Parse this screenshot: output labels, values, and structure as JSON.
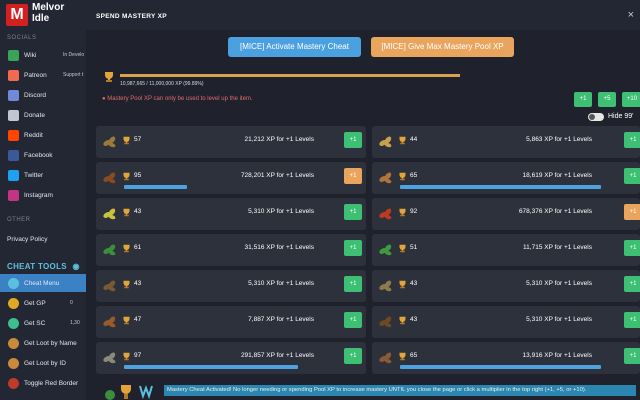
{
  "sidebar": {
    "logo": {
      "line1": "Melvor",
      "line2": "Idle"
    },
    "socials_heading": "SOCIALS",
    "socials": [
      {
        "label": "Wiki",
        "extra": "In Develo",
        "icon": "wiki-icon",
        "color": "#3aa35b"
      },
      {
        "label": "Patreon",
        "extra": "Support t",
        "icon": "patreon-icon",
        "color": "#f06a4f"
      },
      {
        "label": "Discord",
        "extra": "",
        "icon": "discord-icon",
        "color": "#7289da"
      },
      {
        "label": "Donate",
        "extra": "",
        "icon": "donate-icon",
        "color": "#c1c6d2"
      },
      {
        "label": "Reddit",
        "extra": "",
        "icon": "reddit-icon",
        "color": "#ff4500"
      },
      {
        "label": "Facebook",
        "extra": "",
        "icon": "facebook-icon",
        "color": "#3b5998"
      },
      {
        "label": "Twitter",
        "extra": "",
        "icon": "twitter-icon",
        "color": "#1da1f2"
      },
      {
        "label": "Instagram",
        "extra": "",
        "icon": "instagram-icon",
        "color": "#c13584"
      }
    ],
    "other_heading": "OTHER",
    "privacy": "Privacy Policy",
    "cheat_heading": "CHEAT TOOLS",
    "cheats": [
      {
        "label": "Cheat Menu",
        "extra": "",
        "icon": "cheat-menu-icon",
        "color": "#5bc0de"
      },
      {
        "label": "Get GP",
        "extra": "0",
        "icon": "gp-coin-icon",
        "color": "#e0a823"
      },
      {
        "label": "Get SC",
        "extra": "1,30",
        "icon": "sc-coin-icon",
        "color": "#3bbf8c"
      },
      {
        "label": "Get Loot by Name",
        "extra": "",
        "icon": "chest-icon",
        "color": "#c98a3c"
      },
      {
        "label": "Get Loot by ID",
        "extra": "",
        "icon": "chest-id-icon",
        "color": "#c98a3c"
      },
      {
        "label": "Toggle Red Border",
        "extra": "",
        "icon": "red-border-icon",
        "color": "#c0392b"
      }
    ]
  },
  "modal": {
    "title": "SPEND MASTERY XP",
    "close": "×",
    "activate_button": "[MICE] Activate Mastery Cheat",
    "max_pool_button": "[MICE] Give Max Mastery Pool XP",
    "pool_text": "10,987,665 / 11,000,000 XP (99.89%)",
    "pool_fraction": 0.9989,
    "warning": "Mastery Pool XP can only be used to level up the item.",
    "multipliers": [
      "+1",
      "+5",
      "+10"
    ],
    "hide_label": "Hide 99'",
    "items": [
      {
        "level": "57",
        "xp": "21,212 XP for +1 Levels",
        "plus": "+1",
        "progress": 0,
        "leaf_color": "#9b7a3a",
        "plus_color": "green"
      },
      {
        "level": "44",
        "xp": "5,863 XP for +1 Levels",
        "plus": "+1",
        "progress": 0,
        "leaf_color": "#c9a04c",
        "plus_color": "green"
      },
      {
        "level": "95",
        "xp": "728,201 XP for +1 Levels",
        "plus": "+1",
        "progress": 0.3,
        "leaf_color": "#8a4a22",
        "plus_color": "orange"
      },
      {
        "level": "65",
        "xp": "18,619 XP for +1 Levels",
        "plus": "+1",
        "progress": 0.95,
        "leaf_color": "#b0743a",
        "plus_color": "green"
      },
      {
        "level": "43",
        "xp": "5,310 XP for +1 Levels",
        "plus": "+1",
        "progress": 0,
        "leaf_color": "#c9c23a",
        "plus_color": "green"
      },
      {
        "level": "92",
        "xp": "678,376 XP for +1 Levels",
        "plus": "+1",
        "progress": 0,
        "leaf_color": "#c0391f",
        "plus_color": "orange"
      },
      {
        "level": "61",
        "xp": "31,516 XP for +1 Levels",
        "plus": "+1",
        "progress": 0,
        "leaf_color": "#3c8f3a",
        "plus_color": "green"
      },
      {
        "level": "51",
        "xp": "11,715 XP for +1 Levels",
        "plus": "+1",
        "progress": 0,
        "leaf_color": "#3f9a3f",
        "plus_color": "green"
      },
      {
        "level": "43",
        "xp": "5,310 XP for +1 Levels",
        "plus": "+1",
        "progress": 0,
        "leaf_color": "#7a5a32",
        "plus_color": "green"
      },
      {
        "level": "43",
        "xp": "5,310 XP for +1 Levels",
        "plus": "+1",
        "progress": 0,
        "leaf_color": "#8f7a4a",
        "plus_color": "green"
      },
      {
        "level": "47",
        "xp": "7,887 XP for +1 Levels",
        "plus": "+1",
        "progress": 0,
        "leaf_color": "#9a5a2a",
        "plus_color": "green"
      },
      {
        "level": "43",
        "xp": "5,310 XP for +1 Levels",
        "plus": "+1",
        "progress": 0,
        "leaf_color": "#6a4a24",
        "plus_color": "green"
      },
      {
        "level": "97",
        "xp": "291,857 XP for +1 Levels",
        "plus": "+1",
        "progress": 0.83,
        "leaf_color": "#8a8a7a",
        "plus_color": "green"
      },
      {
        "level": "65",
        "xp": "13,916 XP for +1 Levels",
        "plus": "+1",
        "progress": 0.95,
        "leaf_color": "#8a5a34",
        "plus_color": "green"
      }
    ],
    "toast": "Mastery Cheat Activated! No longer needing or spending Pool XP to increase mastery UNTIL you close the page or click a multiplier in the top right (+1, +5, or +10)."
  },
  "colors": {
    "accent_blue": "#4ba0e0",
    "accent_orange": "#e9a55e",
    "success_green": "#3dbf74",
    "warning_red": "#e06a6a"
  }
}
